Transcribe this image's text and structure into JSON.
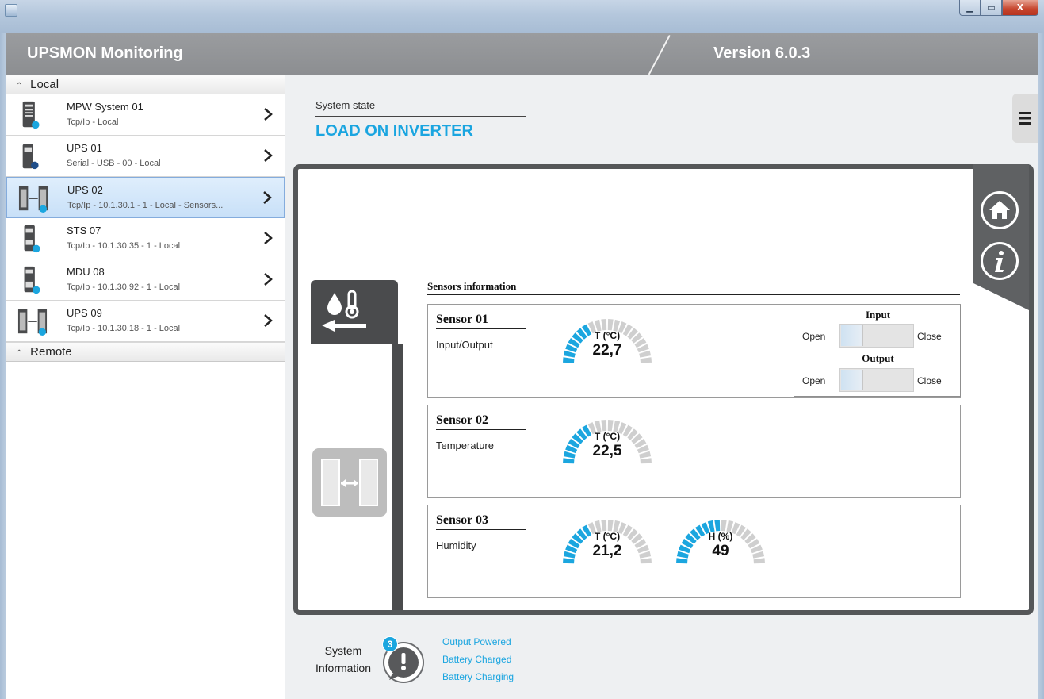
{
  "window": {
    "controls": {
      "minimize": "▁",
      "maximize": "▭",
      "close": "X"
    }
  },
  "header": {
    "title": "UPSMON Monitoring",
    "version": "Version 6.0.3"
  },
  "sidebar": {
    "groups": [
      {
        "label": "Local"
      },
      {
        "label": "Remote"
      }
    ],
    "devices": [
      {
        "name": "MPW System 01",
        "detail": "Tcp/Ip - Local",
        "icon": "ups-tower-icon",
        "status_color": "#1ba6df"
      },
      {
        "name": "UPS 01",
        "detail": "Serial - USB - 00 - Local",
        "icon": "ups-small-icon",
        "status_color": "#1f4e8a"
      },
      {
        "name": "UPS 02",
        "detail": "Tcp/Ip - 10.1.30.1 - 1 - Local - Sensors...",
        "icon": "ups-parallel-icon",
        "status_color": "#1ba6df",
        "selected": true
      },
      {
        "name": "STS 07",
        "detail": "Tcp/Ip - 10.1.30.35 - 1 - Local",
        "icon": "sts-icon",
        "status_color": "#1ba6df"
      },
      {
        "name": "MDU 08",
        "detail": "Tcp/Ip - 10.1.30.92 - 1 - Local",
        "icon": "mdu-icon",
        "status_color": "#1ba6df"
      },
      {
        "name": "UPS 09",
        "detail": "Tcp/Ip - 10.1.30.18 - 1 - Local",
        "icon": "ups-parallel-icon",
        "status_color": "#1ba6df"
      }
    ]
  },
  "main": {
    "state_label": "System state",
    "state_value": "LOAD ON INVERTER",
    "sensors_title": "Sensors information",
    "sensors": [
      {
        "name": "Sensor 01",
        "type": "Input/Output",
        "gauges": [
          {
            "label": "T (°C)",
            "value": "22,7",
            "level": 0.35
          }
        ],
        "io": {
          "input_title": "Input",
          "output_title": "Output",
          "open_label": "Open",
          "close_label": "Close"
        }
      },
      {
        "name": "Sensor 02",
        "type": "Temperature",
        "gauges": [
          {
            "label": "T (°C)",
            "value": "22,5",
            "level": 0.35
          }
        ]
      },
      {
        "name": "Sensor 03",
        "type": "Humidity",
        "gauges": [
          {
            "label": "T (°C)",
            "value": "21,2",
            "level": 0.34
          },
          {
            "label": "H (%)",
            "value": "49",
            "level": 0.49
          }
        ]
      }
    ]
  },
  "system_information": {
    "label_line1": "System",
    "label_line2": "Information",
    "count": "3",
    "messages": [
      "Output Powered",
      "Battery Charged",
      "Battery Charging"
    ]
  },
  "colors": {
    "accent": "#1aa5e0",
    "gauge_active": "#1ba6df",
    "gauge_inactive": "#cfcfcf",
    "panel_border": "#555759"
  }
}
